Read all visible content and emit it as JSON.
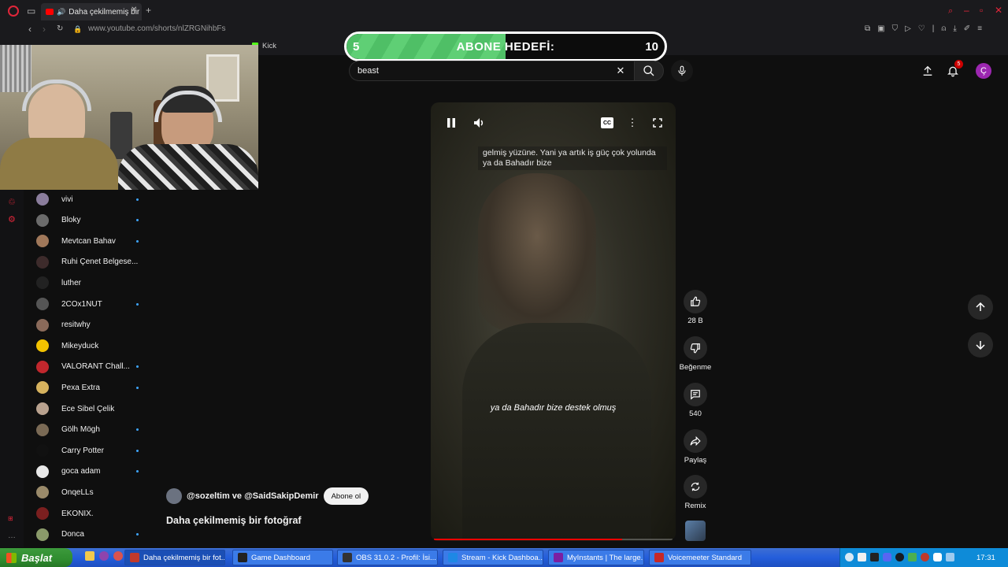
{
  "browser": {
    "tab_title": "Daha çekilmemiş bir fot",
    "url": "www.youtube.com/shorts/nlZRGNihbFs",
    "bookmark_kick": "Kick"
  },
  "goal": {
    "current": "5",
    "title": "ABONE HEDEFİ:",
    "target": "10",
    "progress_fraction": 0.5,
    "color": "#4fbf66"
  },
  "search": {
    "value": "beast"
  },
  "notifications": {
    "count": "5"
  },
  "account": {
    "initial": "Ç",
    "color": "#9c27b0"
  },
  "video": {
    "caption_top": "gelmiş yüzüne. Yani ya artık iş güç çok yolunda ya da Bahadır bize",
    "caption_mid": "ya da Bahadır bize destek olmuş",
    "progress_fraction": 0.79
  },
  "actions": {
    "likes": "28 B",
    "dislike": "Beğenme",
    "comments": "540",
    "share": "Paylaş",
    "remix": "Remix"
  },
  "channel": {
    "names": "@sozeltim ve @SaidSakipDemir",
    "subscribe": "Abone ol",
    "title": "Daha çekilmemiş bir fotoğraf"
  },
  "subscriptions": [
    {
      "name": "vivi",
      "live": true,
      "color": "#8a7d9c"
    },
    {
      "name": "Bloky",
      "live": true,
      "color": "#6b6b6b"
    },
    {
      "name": "Mevtcan Bahav",
      "live": true,
      "color": "#a0785a"
    },
    {
      "name": "Ruhi Çenet Belgese...",
      "live": false,
      "color": "#3d2b2b"
    },
    {
      "name": "luther",
      "live": false,
      "color": "#222222"
    },
    {
      "name": "2COx1NUT",
      "live": true,
      "color": "#555555"
    },
    {
      "name": "resitwhy",
      "live": false,
      "color": "#8a6a5a"
    },
    {
      "name": "Mikeyduck",
      "live": false,
      "color": "#f2c200"
    },
    {
      "name": "VALORANT Chall...",
      "live": true,
      "color": "#c1272d"
    },
    {
      "name": "Pexa Extra",
      "live": true,
      "color": "#d6b25e"
    },
    {
      "name": "Ece Sibel Çelik",
      "live": false,
      "color": "#b9a28f"
    },
    {
      "name": "Gölh Mögh",
      "live": true,
      "color": "#7a6a55"
    },
    {
      "name": "Carry Potter",
      "live": true,
      "color": "#111111"
    },
    {
      "name": "goca adam",
      "live": true,
      "color": "#e8e8e8"
    },
    {
      "name": "OnqeLLs",
      "live": false,
      "color": "#9a8a6a"
    },
    {
      "name": "EKONIX.",
      "live": false,
      "color": "#7a1f1f"
    },
    {
      "name": "Donca",
      "live": true,
      "color": "#8a9a6a"
    }
  ],
  "taskbar": {
    "start": "Başlat",
    "tasks": [
      {
        "label": "Daha çekilmemiş bir fot...",
        "color": "#c0392b"
      },
      {
        "label": "Game Dashboard",
        "color": "#222222"
      },
      {
        "label": "OBS 31.0.2 - Profil: İsi...",
        "color": "#333333"
      },
      {
        "label": "Stream - Kick Dashboa...",
        "color": "#1e88e5"
      },
      {
        "label": "MyInstants | The large...",
        "color": "#7b1fa2"
      },
      {
        "label": "Voicemeeter Standard",
        "color": "#c62828"
      }
    ],
    "clock": "17:31"
  }
}
